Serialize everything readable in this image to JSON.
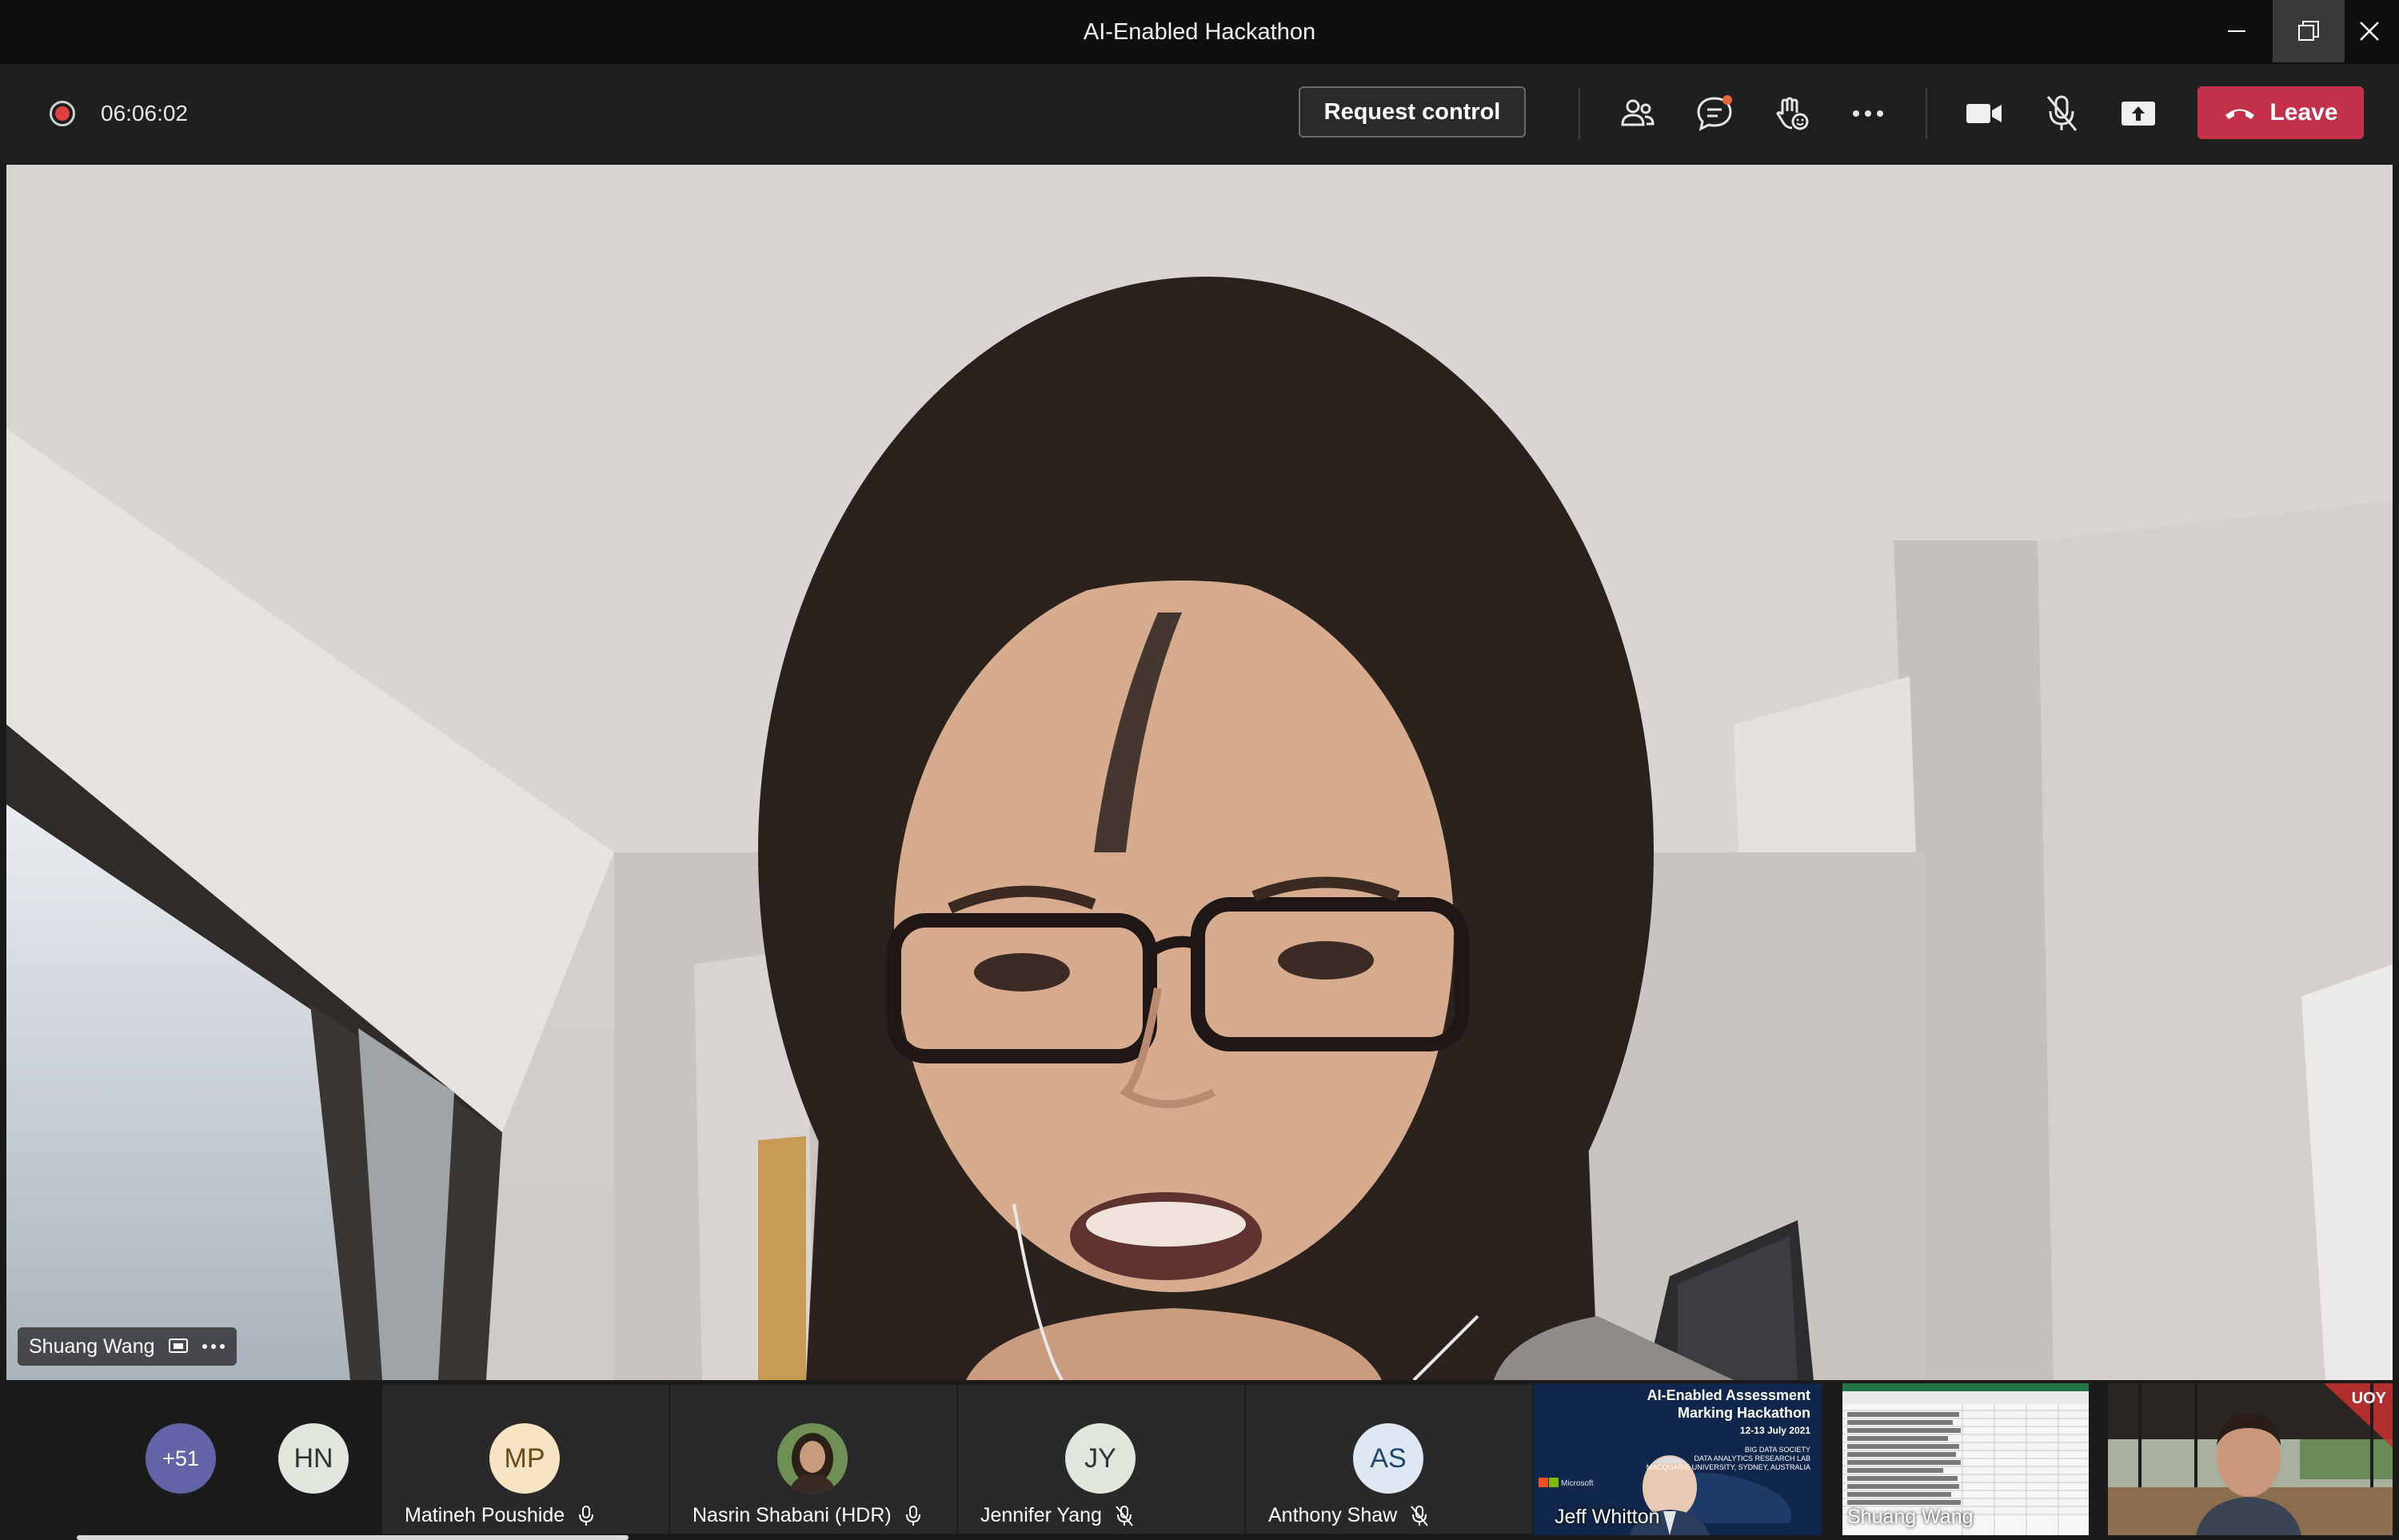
{
  "window": {
    "title": "AI-Enabled Hackathon"
  },
  "toolbar": {
    "timer": "06:06:02",
    "request_control_label": "Request control",
    "leave_label": "Leave",
    "accent_color": "#c4314b",
    "icons": [
      "participants-icon",
      "chat-icon",
      "reactions-icon",
      "more-icon",
      "camera-icon",
      "mic-off-icon",
      "share-icon"
    ]
  },
  "stage": {
    "speaker_name": "Shuang Wang"
  },
  "participants_strip": {
    "overflow_count": "+51",
    "tiles": [
      {
        "initials": "HN",
        "name": ""
      },
      {
        "initials": "MP",
        "name": "Matineh Poushide"
      },
      {
        "initials": "",
        "name": "Nasrin Shabani (HDR)"
      },
      {
        "initials": "JY",
        "name": "Jennifer Yang"
      },
      {
        "initials": "AS",
        "name": "Anthony Shaw"
      }
    ],
    "video_tiles": [
      {
        "name": "Jeff Whitton",
        "slide_title": "AI-Enabled Assessment",
        "slide_title2": "Marking Hackathon",
        "slide_date": "12-13 July 2021",
        "slide_org1": "BIG DATA SOCIETY",
        "slide_org2": "DATA ANALYTICS RESEARCH LAB",
        "slide_org3": "MACQUARIE UNIVERSITY, SYDNEY, AUSTRALIA",
        "slide_logo": "Microsoft"
      },
      {
        "name": "Shuang Wang"
      },
      {
        "name": "",
        "badge": "UOY"
      }
    ]
  }
}
